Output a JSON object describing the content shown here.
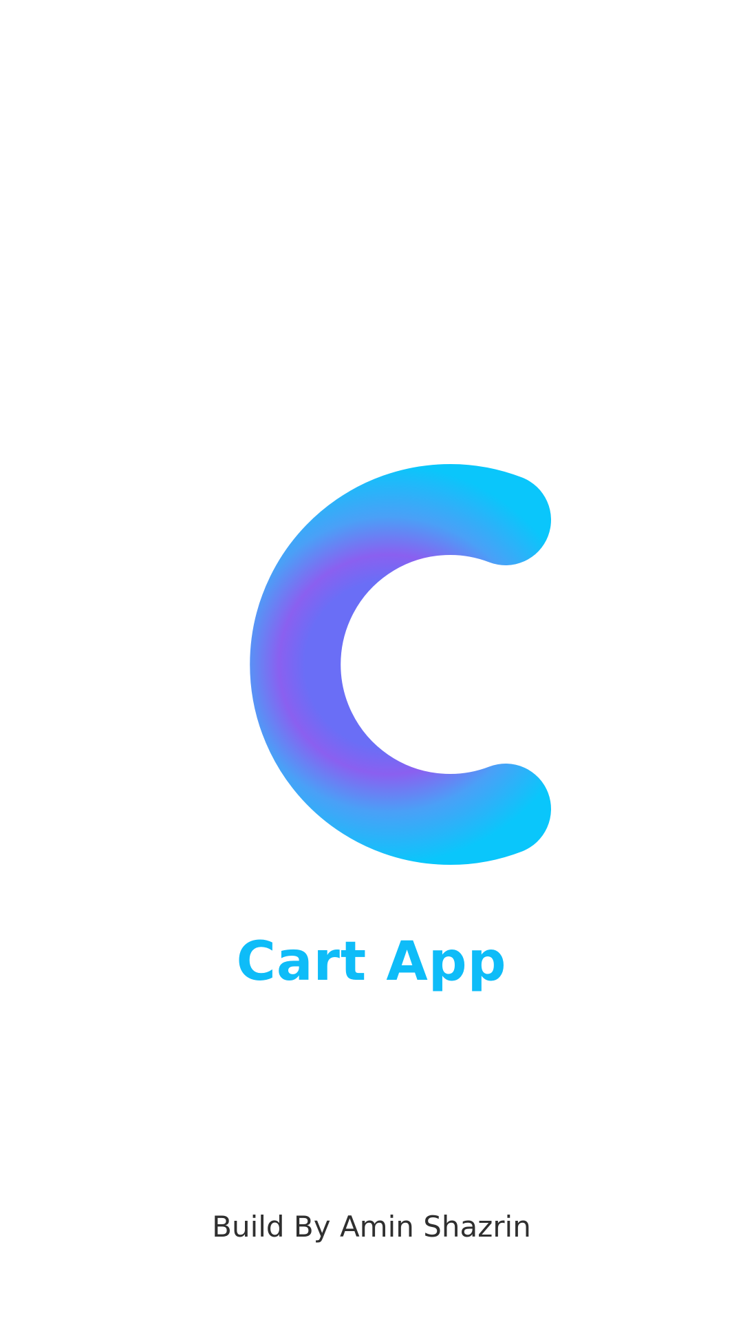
{
  "app": {
    "title": "Cart App",
    "credit": "Build By Amin Shazrin"
  },
  "logo": {
    "icon": "c-ring-logo-icon",
    "gradient_outer": "#0ac6fb",
    "gradient_mid": "#4aa0f7",
    "gradient_inner": "#8a60f0"
  },
  "colors": {
    "background": "#ffffff",
    "title": "#0ebcf8",
    "credit": "#2f2f2f"
  }
}
